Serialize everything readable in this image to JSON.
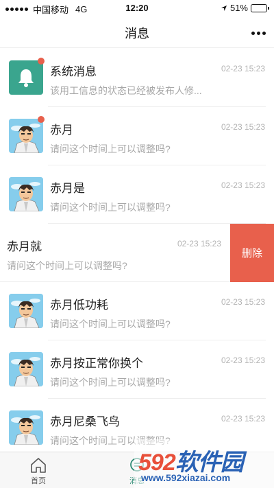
{
  "status_bar": {
    "carrier": "中国移动",
    "network": "4G",
    "time": "12:20",
    "battery": "51%",
    "battery_level": 0.51
  },
  "nav": {
    "title": "消息",
    "more_icon": "more-dots-icon"
  },
  "messages": [
    {
      "name": "系统消息",
      "time": "02-23 15:23",
      "preview": "该用工信息的状态已经被发布人修...",
      "unread": true,
      "avatar": "bell-icon"
    },
    {
      "name": "赤月",
      "time": "02-23 15:23",
      "preview": "请问这个时间上可以调整吗?",
      "unread": true,
      "avatar": "user-avatar"
    },
    {
      "name": "赤月是",
      "time": "02-23 15:23",
      "preview": "请问这个时间上可以调整吗?",
      "unread": false,
      "avatar": "user-avatar"
    },
    {
      "name": "赤月就",
      "time": "02-23 15:23",
      "preview": "请问这个时间上可以调整吗?",
      "unread": false,
      "avatar": "user-avatar",
      "delete_label": "删除"
    },
    {
      "name": "赤月低功耗",
      "time": "02-23 15:23",
      "preview": "请问这个时间上可以调整吗?",
      "unread": false,
      "avatar": "user-avatar"
    },
    {
      "name": "赤月按正常你换个",
      "time": "02-23 15:23",
      "preview": "请问这个时间上可以调整吗?",
      "unread": false,
      "avatar": "user-avatar"
    },
    {
      "name": "赤月尼桑飞鸟",
      "time": "02-23 15:23",
      "preview": "请问这个时间上可以调整吗?",
      "unread": false,
      "avatar": "user-avatar"
    }
  ],
  "tabbar": {
    "home_label": "首页",
    "messages_label": "消息"
  },
  "watermark": {
    "logo_num": "592",
    "logo_text": "软件园",
    "url": "www.592xiazai.com"
  },
  "colors": {
    "accent_green": "#3aa58e",
    "unread_dot": "#e8604c",
    "delete_bg": "#e8604c"
  }
}
